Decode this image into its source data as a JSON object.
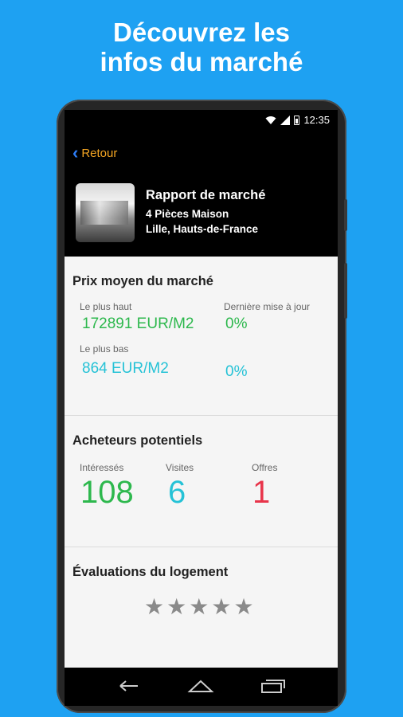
{
  "headline": {
    "line1": "Découvrez les",
    "line2": "infos du marché"
  },
  "status_bar": {
    "time": "12:35"
  },
  "nav": {
    "back_label": "Retour"
  },
  "report": {
    "title": "Rapport de marché",
    "subtitle": "4 Pièces Maison",
    "location": "Lille, Hauts-de-France"
  },
  "price": {
    "title": "Prix moyen du marché",
    "high_label": "Le plus haut",
    "high_value": "172891 EUR/M2",
    "update_label": "Dernière mise à jour",
    "high_change": "0%",
    "low_label": "Le plus bas",
    "low_value": "864 EUR/M2",
    "low_change": "0%"
  },
  "buyers": {
    "title": "Acheteurs potentiels",
    "interested_label": "Intéressés",
    "interested_value": "108",
    "visits_label": "Visites",
    "visits_value": "6",
    "offers_label": "Offres",
    "offers_value": "1"
  },
  "ratings": {
    "title": "Évaluations du logement",
    "stars": 0,
    "stars_max": 5
  },
  "colors": {
    "background": "#1ea1f2",
    "green": "#2db84d",
    "teal": "#25c2d6",
    "red": "#e8344a",
    "back_link": "#f5a623"
  }
}
